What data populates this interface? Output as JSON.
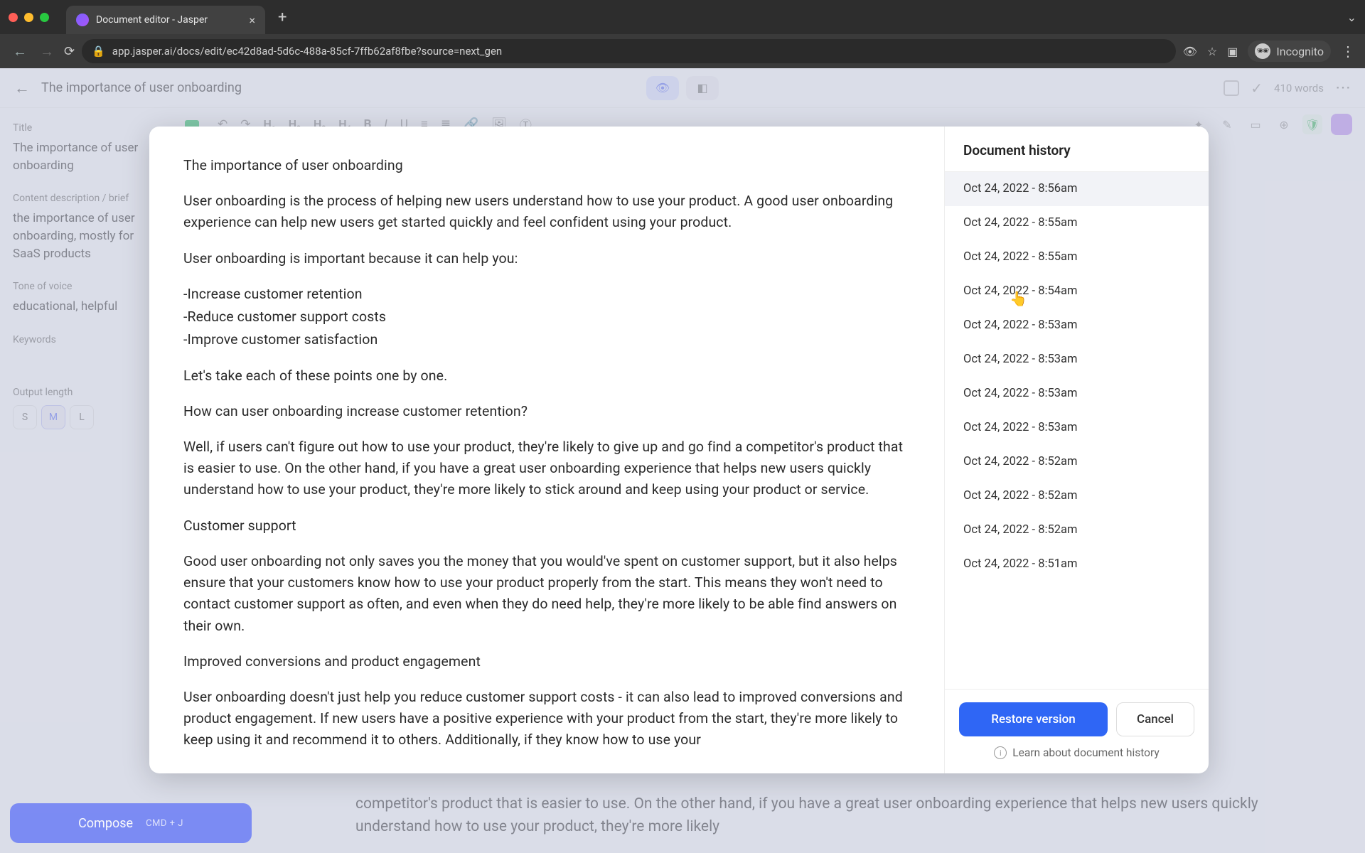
{
  "browser": {
    "tab_title": "Document editor - Jasper",
    "url": "app.jasper.ai/docs/edit/ec42d8ad-5d6c-488a-85cf-7ffb62af8fbe?source=next_gen",
    "incognito_label": "Incognito"
  },
  "header": {
    "doc_title": "The importance of user onboarding",
    "word_count": "410 words"
  },
  "sidebar": {
    "title_label": "Title",
    "title_value": "The importance of user onboarding",
    "brief_label": "Content description / brief",
    "brief_value": "the importance of user onboarding, mostly for SaaS products",
    "tone_label": "Tone of voice",
    "tone_value": "educational, helpful",
    "keywords_label": "Keywords",
    "output_label": "Output length",
    "lengths": {
      "s": "S",
      "m": "M",
      "l": "L"
    }
  },
  "compose": {
    "label": "Compose",
    "shortcut": "CMD + J"
  },
  "bg_doc_tail": "competitor's product that is easier to use. On the other hand, if you have a great user onboarding experience that helps new users quickly understand how to use your product, they're more likely",
  "modal_doc": {
    "title": "The importance of user onboarding",
    "p1": "User onboarding is the process of helping new users understand how to use your product. A good user onboarding experience can help new users get started quickly and feel confident using your product.",
    "p2": "User onboarding is important because it can help you:",
    "b1": "-Increase customer retention",
    "b2": "-Reduce customer support costs",
    "b3": "-Improve customer satisfaction",
    "p3": "Let's take each of these points one by one.",
    "p4": "How can user onboarding increase customer retention?",
    "p5": "Well, if users can't figure out how to use your product, they're likely to give up and go find a competitor's product that is easier to use. On the other hand, if you have a great user onboarding experience that helps new users quickly understand how to use your product, they're more likely to stick around and keep using your product or service.",
    "h2": "Customer support",
    "p6": "Good user onboarding not only saves you the money that you would've spent on customer support, but it also helps ensure that your customers know how to use your product properly from the start. This means they won't need to contact customer support as often, and even when they do need help, they're more likely to be able find answers on their own.",
    "h3": "Improved conversions and product engagement",
    "p7": "User onboarding doesn't just help you reduce customer support costs - it can also lead to improved conversions and product engagement. If new users have a positive experience with your product from the start, they're more likely to keep using it and recommend it to others. Additionally, if they know how to use your"
  },
  "history": {
    "title": "Document history",
    "items": [
      "Oct 24, 2022 - 8:56am",
      "Oct 24, 2022 - 8:55am",
      "Oct 24, 2022 - 8:55am",
      "Oct 24, 2022 - 8:54am",
      "Oct 24, 2022 - 8:53am",
      "Oct 24, 2022 - 8:53am",
      "Oct 24, 2022 - 8:53am",
      "Oct 24, 2022 - 8:53am",
      "Oct 24, 2022 - 8:52am",
      "Oct 24, 2022 - 8:52am",
      "Oct 24, 2022 - 8:52am",
      "Oct 24, 2022 - 8:51am"
    ],
    "restore_label": "Restore version",
    "cancel_label": "Cancel",
    "learn_label": "Learn about document history"
  }
}
